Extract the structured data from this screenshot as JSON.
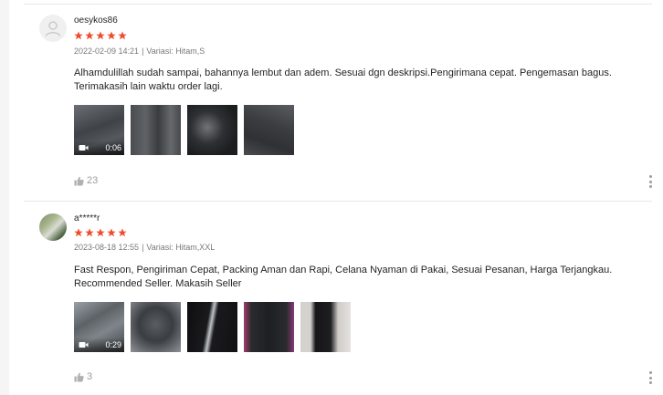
{
  "reviews": [
    {
      "username": "oesykos86",
      "rating": 5,
      "date": "2022-02-09 14:21",
      "separator": "|",
      "variation": "Variasi: Hitam,S",
      "comment": "Alhamdulillah sudah sampai, bahannya lembut dan adem. Sesuai dgn deskripsi.Pengirimana cepat. Pengemasan bagus. Terimakasih lain waktu order lagi.",
      "video_duration": "0:06",
      "likes": "23",
      "avatar_icon": "default-user-icon"
    },
    {
      "username": "a*****r",
      "rating": 5,
      "date": "2023-08-18 12:55",
      "separator": "|",
      "variation": "Variasi: Hitam,XXL",
      "comment": "Fast Respon, Pengiriman Cepat, Packing Aman dan Rapi, Celana Nyaman di Pakai, Sesuai Pesanan, Harga Terjangkau. Recommended Seller. Makasih Seller",
      "video_duration": "0:29",
      "likes": "3",
      "avatar_icon": "user-photo"
    }
  ],
  "colors": {
    "star": "#ee4d2d",
    "muted_text": "rgba(0,0,0,0.54)",
    "divider": "#e8e8e8"
  },
  "icons": {
    "star": "star-icon",
    "like": "thumbs-up-icon",
    "video": "video-camera-icon",
    "more": "more-vertical-icon"
  }
}
